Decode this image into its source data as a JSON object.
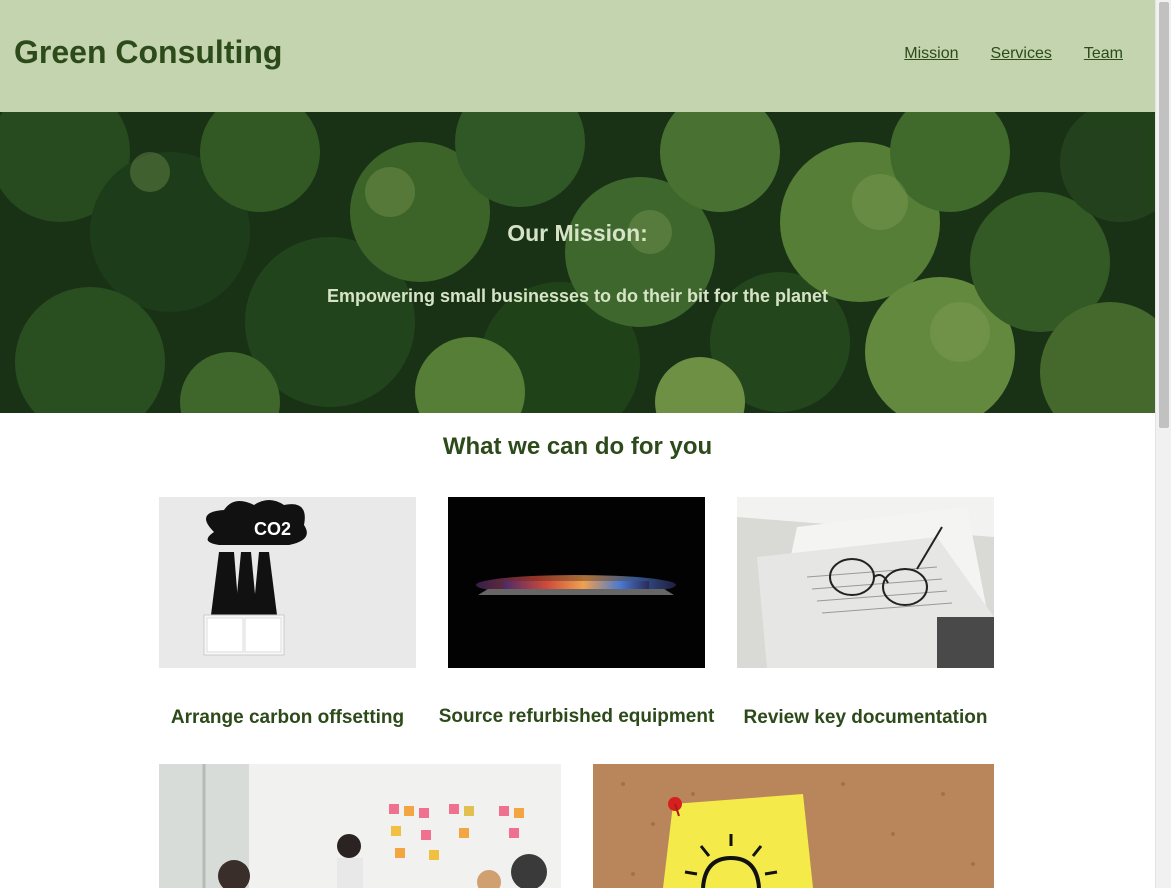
{
  "header": {
    "brand": "Green Consulting",
    "nav": [
      {
        "label": "Mission"
      },
      {
        "label": "Services"
      },
      {
        "label": "Team"
      }
    ]
  },
  "hero": {
    "title": "Our Mission:",
    "subtitle": "Empowering small businesses to do their bit for the planet"
  },
  "services": {
    "title": "What we can do for you",
    "cards": [
      {
        "label": "Arrange carbon offsetting",
        "image_text": "CO2"
      },
      {
        "label": "Source refurbished equipment"
      },
      {
        "label": "Review key documentation"
      }
    ]
  },
  "colors": {
    "header_bg": "#c3d4ae",
    "brand_text": "#2c4a1a",
    "hero_text": "#d6e3c6"
  }
}
